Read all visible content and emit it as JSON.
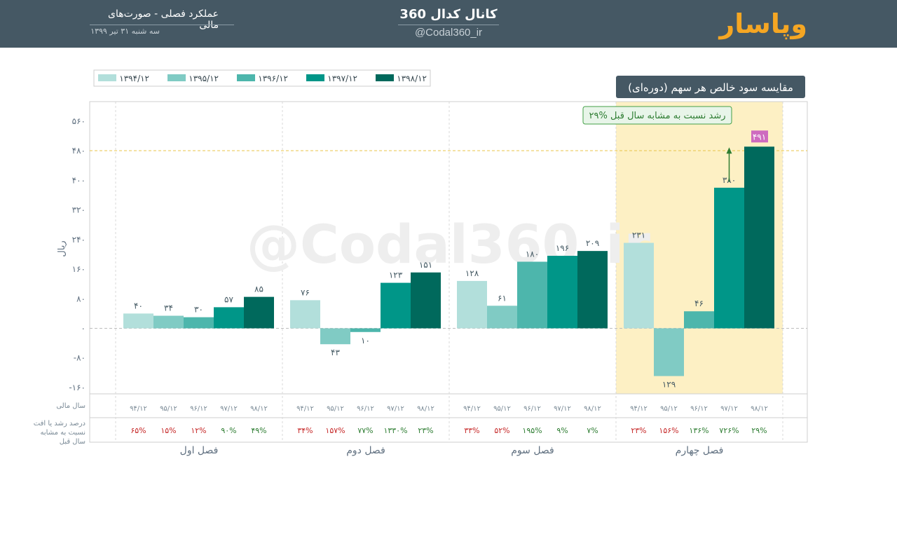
{
  "header": {
    "brand": "وپاسار",
    "channel_title": "کانال کدال 360",
    "channel_handle": "@Codal360_ir",
    "report_title": "عملکرد فصلی - صورت‌های مالی",
    "report_date": "سه شنبه ۳۱ تیر ۱۳۹۹"
  },
  "chart_data": {
    "type": "bar",
    "title": "مقایسه سود خالص هر سهم (دوره‌ای)",
    "ylabel": "ریال",
    "ylim": [
      -180,
      600
    ],
    "y_ticks": [
      -160,
      -80,
      0,
      80,
      160,
      240,
      320,
      400,
      480,
      560
    ],
    "y_tick_labels": [
      "-۱۶۰",
      "-۸۰",
      "۰",
      "۸۰",
      "۱۶۰",
      "۲۴۰",
      "۳۲۰",
      "۴۰۰",
      "۴۸۰",
      "۵۶۰"
    ],
    "watermark": "@Codal360_ir",
    "legend_position": "top-left",
    "series": [
      {
        "name": "۱۳۹۴/۱۲",
        "short": "۹۴/۱۲",
        "color": "#b2dfdb",
        "values": [
          40,
          76,
          128,
          231
        ],
        "labels": [
          "۴۰",
          "۷۶",
          "۱۲۸",
          "۲۳۱"
        ]
      },
      {
        "name": "۱۳۹۵/۱۲",
        "short": "۹۵/۱۲",
        "color": "#80cbc4",
        "values": [
          34,
          -43,
          61,
          -129
        ],
        "labels": [
          "۳۴",
          "۴۳",
          "۶۱",
          "۱۲۹"
        ]
      },
      {
        "name": "۱۳۹۶/۱۲",
        "short": "۹۶/۱۲",
        "color": "#4db6ac",
        "values": [
          30,
          -10,
          180,
          46
        ],
        "labels": [
          "۳۰",
          "۱۰",
          "۱۸۰",
          "۴۶"
        ]
      },
      {
        "name": "۱۳۹۷/۱۲",
        "short": "۹۷/۱۲",
        "color": "#009688",
        "values": [
          57,
          123,
          196,
          380
        ],
        "labels": [
          "۵۷",
          "۱۲۳",
          "۱۹۶",
          "۳۸۰"
        ]
      },
      {
        "name": "۱۳۹۸/۱۲",
        "short": "۹۸/۱۲",
        "color": "#00695c",
        "values": [
          85,
          151,
          209,
          491
        ],
        "labels": [
          "۸۵",
          "۱۵۱",
          "۲۰۹",
          "۴۹۱"
        ]
      }
    ],
    "groups": [
      "فصل اول",
      "فصل دوم",
      "فصل سوم",
      "فصل چهارم"
    ],
    "highlight_group": 3,
    "row_labels": {
      "fiscal_year": "سال مالی",
      "growth": [
        "درصد رشد یا افت",
        "نسبت به مشابه",
        "سال قبل"
      ]
    },
    "growth_pct": [
      [
        {
          "t": "۶۵%",
          "up": false
        },
        {
          "t": "۱۵%",
          "up": false
        },
        {
          "t": "۱۲%",
          "up": false
        },
        {
          "t": "۹۰%",
          "up": true
        },
        {
          "t": "۴۹%",
          "up": true
        }
      ],
      [
        {
          "t": "۳۴%",
          "up": false
        },
        {
          "t": "۱۵۷%",
          "up": false
        },
        {
          "t": "۷۷%",
          "up": true
        },
        {
          "t": "۱۳۳۰%",
          "up": true
        },
        {
          "t": "۲۳%",
          "up": true
        }
      ],
      [
        {
          "t": "۳۳%",
          "up": false
        },
        {
          "t": "۵۲%",
          "up": false
        },
        {
          "t": "۱۹۵%",
          "up": true
        },
        {
          "t": "۹%",
          "up": true
        },
        {
          "t": "۷%",
          "up": true
        }
      ],
      [
        {
          "t": "۲۳%",
          "up": false
        },
        {
          "t": "۱۵۶%",
          "up": false
        },
        {
          "t": "۱۳۶%",
          "up": true
        },
        {
          "t": "۷۲۶%",
          "up": true
        },
        {
          "t": "۲۹%",
          "up": true
        }
      ]
    ],
    "annotation": {
      "text": "۲۹% رشد نسبت به مشابه سال قبل",
      "value": 491,
      "label": "۴۹۱"
    },
    "reference_line": 480,
    "colors": {
      "up": "#2e7d32",
      "down": "#c62828",
      "highlight_fill": "#fdf0c4",
      "max_label": "#ce6bbf",
      "title_bg": "#455864"
    }
  }
}
